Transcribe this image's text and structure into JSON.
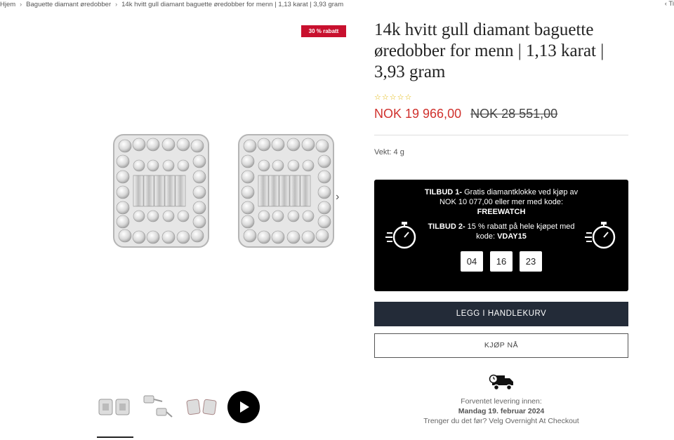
{
  "breadcrumb": {
    "home": "Hjem",
    "category": "Baguette diamant øredobber",
    "current": "14k hvitt gull diamant baguette øredobber for menn | 1,13 karat | 3,93 gram",
    "right": "‹ Ti"
  },
  "gallery": {
    "badge": "30 % rabatt",
    "next_icon": "chevron-right-icon",
    "thumbnails": [
      "earrings-front",
      "earrings-side",
      "earrings-angle",
      "video"
    ]
  },
  "product": {
    "title": "14k hvitt gull diamant baguette øredobber for menn | 1,13 karat | 3,93 gram",
    "stars": "☆☆☆☆☆",
    "price_now": "NOK 19 966,00",
    "price_old": "NOK 28 551,00",
    "weight": "Vekt: 4 g"
  },
  "offer": {
    "offer1_label": "TILBUD 1-",
    "offer1_text": " Gratis diamantklokke ved kjøp av NOK 10 077,00 eller mer med kode: ",
    "offer1_code": "FREEWATCH",
    "offer2_label": "TILBUD 2-",
    "offer2_text": " 15 % rabatt på hele kjøpet med kode: ",
    "offer2_code": "VDAY15",
    "timer": [
      "04",
      "16",
      "23"
    ]
  },
  "actions": {
    "add_to_cart": "LEGG I HANDLEKURV",
    "buy_now": "KJØP NÅ"
  },
  "delivery": {
    "label": "Forventet levering innen:",
    "date": "Mandag 19. februar 2024",
    "note": "Trenger du det før? Velg Overnight At Checkout"
  },
  "colors": {
    "accent_red": "#d0312d",
    "badge_red": "#c8102e",
    "cart_button": "#232b38",
    "stars": "#e0b400"
  }
}
